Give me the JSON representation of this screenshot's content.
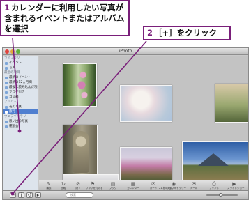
{
  "callouts": {
    "c1_num": "1",
    "c1_text": "カレンダーに利用したい写真が含まれるイベントまたはアルバムを選択",
    "c2_num": "2",
    "c2_text": "［+］をクリック"
  },
  "window": {
    "title": "iPhoto"
  },
  "sidebar": {
    "items": [
      {
        "label": "ライブラリ",
        "kind": "head"
      },
      {
        "label": "イベント",
        "kind": "item"
      },
      {
        "label": "写真",
        "kind": "item"
      },
      {
        "label": "最近の項目",
        "kind": "head"
      },
      {
        "label": "最新のイベント",
        "kind": "item"
      },
      {
        "label": "最新の12ヵ月間",
        "kind": "item"
      },
      {
        "label": "最後に読み込んだ項目",
        "kind": "item"
      },
      {
        "label": "フラグ付き",
        "kind": "item"
      },
      {
        "label": "ゴミ箱",
        "kind": "item"
      },
      {
        "label": "アルバム",
        "kind": "head"
      },
      {
        "label": "花の写真",
        "kind": "item"
      },
      {
        "label": "旅行",
        "kind": "selected"
      },
      {
        "label": "ウェブギャラリー",
        "kind": "head"
      },
      {
        "label": "思い出の写真",
        "kind": "item"
      },
      {
        "label": "運動会",
        "kind": "item"
      }
    ]
  },
  "toolbar": {
    "items": [
      "編集",
      "回転",
      "隠す",
      "フラグを付ける",
      "ブック",
      "カレンダー",
      "カード",
      "ウェブギャラリー",
      "メール",
      "プリント",
      "スライドショー"
    ],
    "photo_count": "21 枚の写真"
  },
  "bottombar": {
    "add_glyph": "+",
    "search_placeholder": "検索"
  },
  "zoom": {
    "level": 0.45
  },
  "colors": {
    "callout_border": "#7a1f7a",
    "selection": "#4f7fd0"
  }
}
